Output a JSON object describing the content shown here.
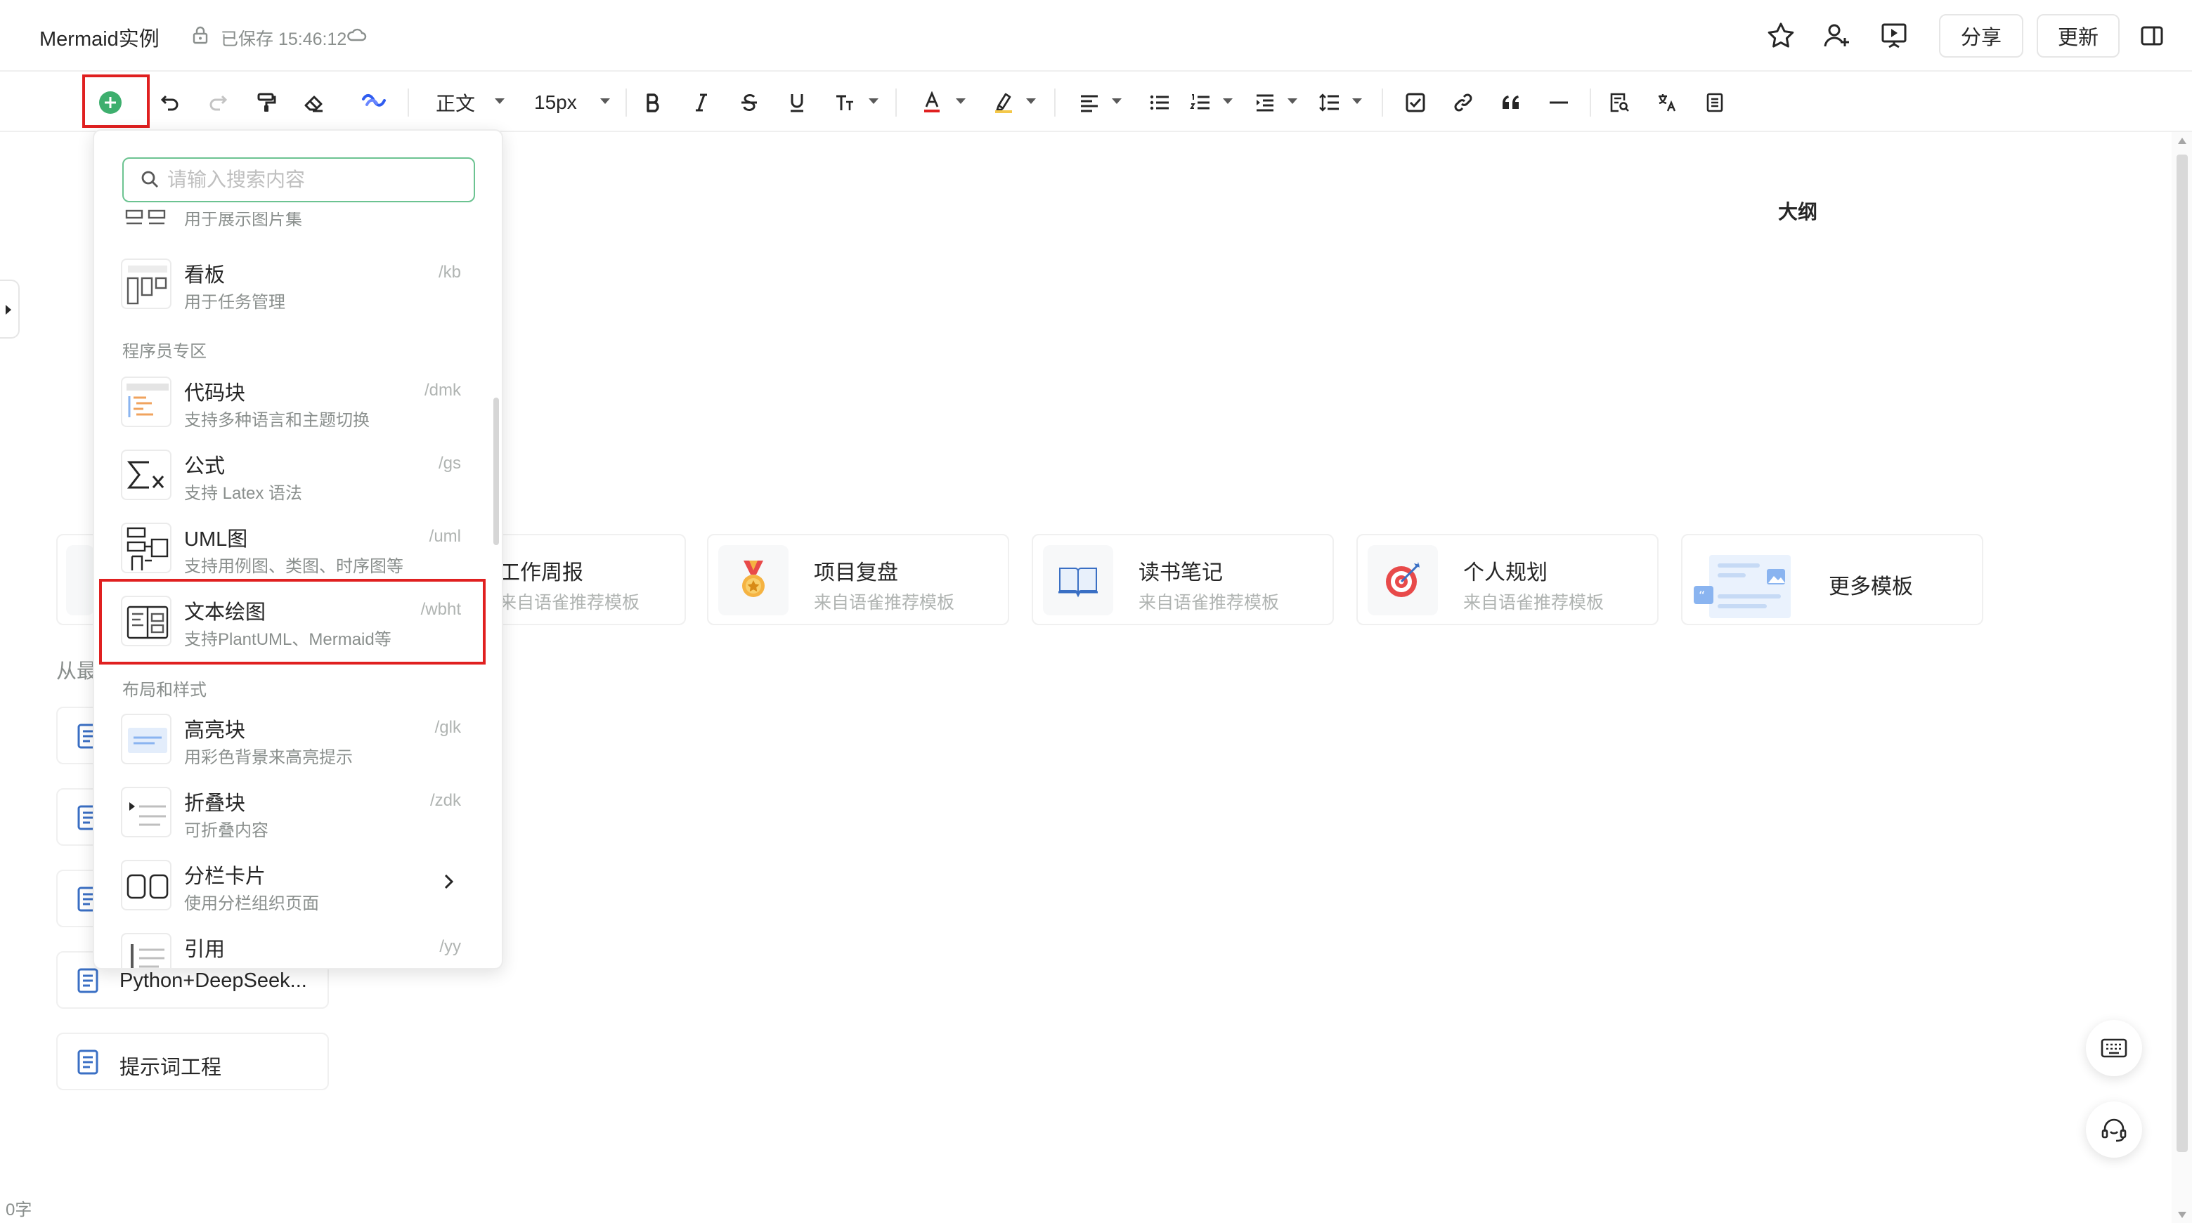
{
  "header": {
    "doc_title": "Mermaid实例",
    "save_status": "已保存 15:46:12",
    "share_label": "分享",
    "update_label": "更新"
  },
  "toolbar": {
    "paragraph_style": "正文",
    "font_size": "15px"
  },
  "insert_menu": {
    "search_placeholder": "请输入搜索内容",
    "partial_top_desc": "用于展示图片集",
    "items": [
      {
        "name": "看板",
        "desc": "用于任务管理",
        "shortcut": "/kb"
      },
      {
        "name": "代码块",
        "desc": "支持多种语言和主题切换",
        "shortcut": "/dmk"
      },
      {
        "name": "公式",
        "desc": "支持 Latex 语法",
        "shortcut": "/gs"
      },
      {
        "name": "UML图",
        "desc": "支持用例图、类图、时序图等",
        "shortcut": "/uml"
      },
      {
        "name": "文本绘图",
        "desc": "支持PlantUML、Mermaid等",
        "shortcut": "/wbht"
      },
      {
        "name": "高亮块",
        "desc": "用彩色背景来高亮提示",
        "shortcut": "/glk"
      },
      {
        "name": "折叠块",
        "desc": "可折叠内容",
        "shortcut": "/zdk"
      },
      {
        "name": "分栏卡片",
        "desc": "使用分栏组织页面",
        "shortcut": ""
      },
      {
        "name": "引用",
        "desc": "",
        "shortcut": "/yy"
      }
    ],
    "sections": {
      "programmer": "程序员专区",
      "layout": "布局和样式"
    }
  },
  "outline": {
    "title": "大纲"
  },
  "templates": [
    {
      "name": "工作周报",
      "source": "来自语雀推荐模板"
    },
    {
      "name": "项目复盘",
      "source": "来自语雀推荐模板"
    },
    {
      "name": "读书笔记",
      "source": "来自语雀推荐模板"
    },
    {
      "name": "个人规划",
      "source": "来自语雀推荐模板"
    },
    {
      "name": "更多模板",
      "source": ""
    }
  ],
  "recent": {
    "heading_partial": "从最",
    "docs": [
      {
        "name": "Python+DeepSeek..."
      },
      {
        "name": "提示词工程"
      }
    ]
  },
  "status": {
    "word_count": "0字"
  },
  "colors": {
    "accent_green": "#3eaf6e",
    "highlight_red": "#e02020"
  }
}
